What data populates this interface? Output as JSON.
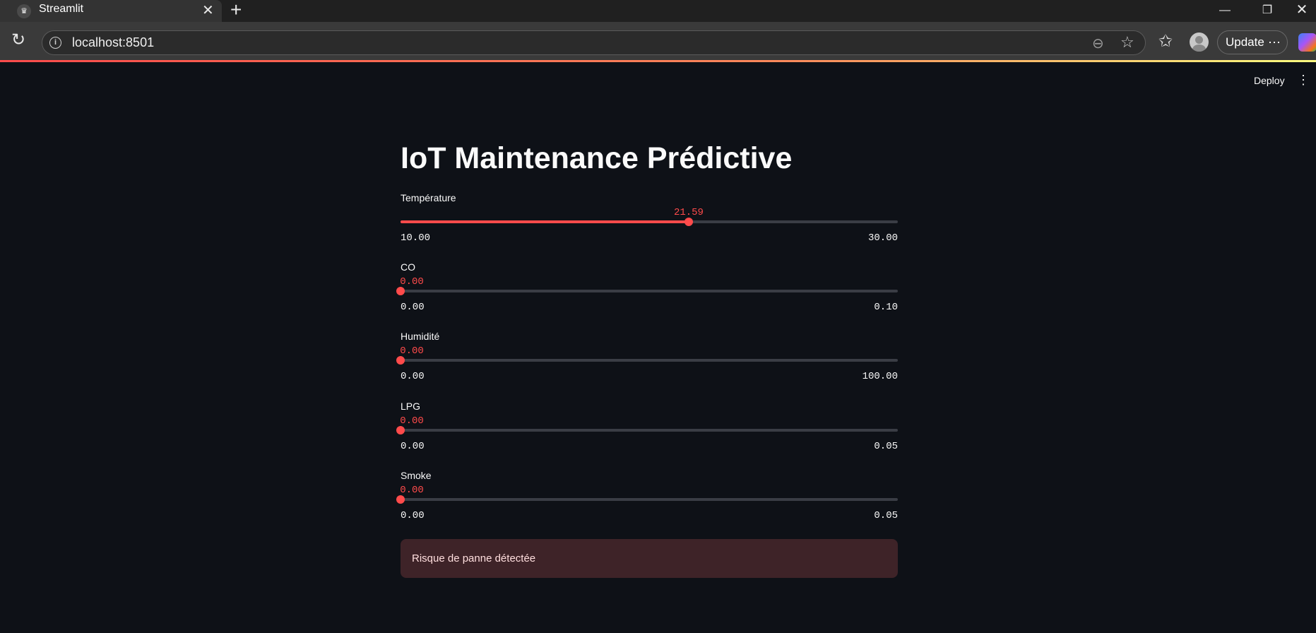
{
  "browser": {
    "tab_title": "Streamlit",
    "url": "localhost:8501",
    "update_label": "Update"
  },
  "app": {
    "deploy_label": "Deploy",
    "title": "IoT Maintenance Prédictive",
    "sliders": [
      {
        "label": "Température",
        "value": 21.59,
        "value_text": "21.59",
        "min": 10.0,
        "max": 30.0,
        "min_text": "10.00",
        "max_text": "30.00"
      },
      {
        "label": "CO",
        "value": 0.0,
        "value_text": "0.00",
        "min": 0.0,
        "max": 0.1,
        "min_text": "0.00",
        "max_text": "0.10"
      },
      {
        "label": "Humidité",
        "value": 0.0,
        "value_text": "0.00",
        "min": 0.0,
        "max": 100.0,
        "min_text": "0.00",
        "max_text": "100.00"
      },
      {
        "label": "LPG",
        "value": 0.0,
        "value_text": "0.00",
        "min": 0.0,
        "max": 0.05,
        "min_text": "0.00",
        "max_text": "0.05"
      },
      {
        "label": "Smoke",
        "value": 0.0,
        "value_text": "0.00",
        "min": 0.0,
        "max": 0.05,
        "min_text": "0.00",
        "max_text": "0.05"
      }
    ],
    "alert_text": "Risque de panne détectée"
  },
  "colors": {
    "background": "#0e1117",
    "accent": "#ff4b4b",
    "alert_bg": "#3e2328"
  },
  "icons": {
    "favicon": "streamlit-crown-icon",
    "reload": "reload-icon",
    "info": "info-icon",
    "zoom": "zoom-out-icon",
    "star": "star-icon",
    "favorites": "favorites-icon",
    "profile": "profile-avatar",
    "more": "more-icon",
    "menu": "kebab-menu-icon"
  }
}
